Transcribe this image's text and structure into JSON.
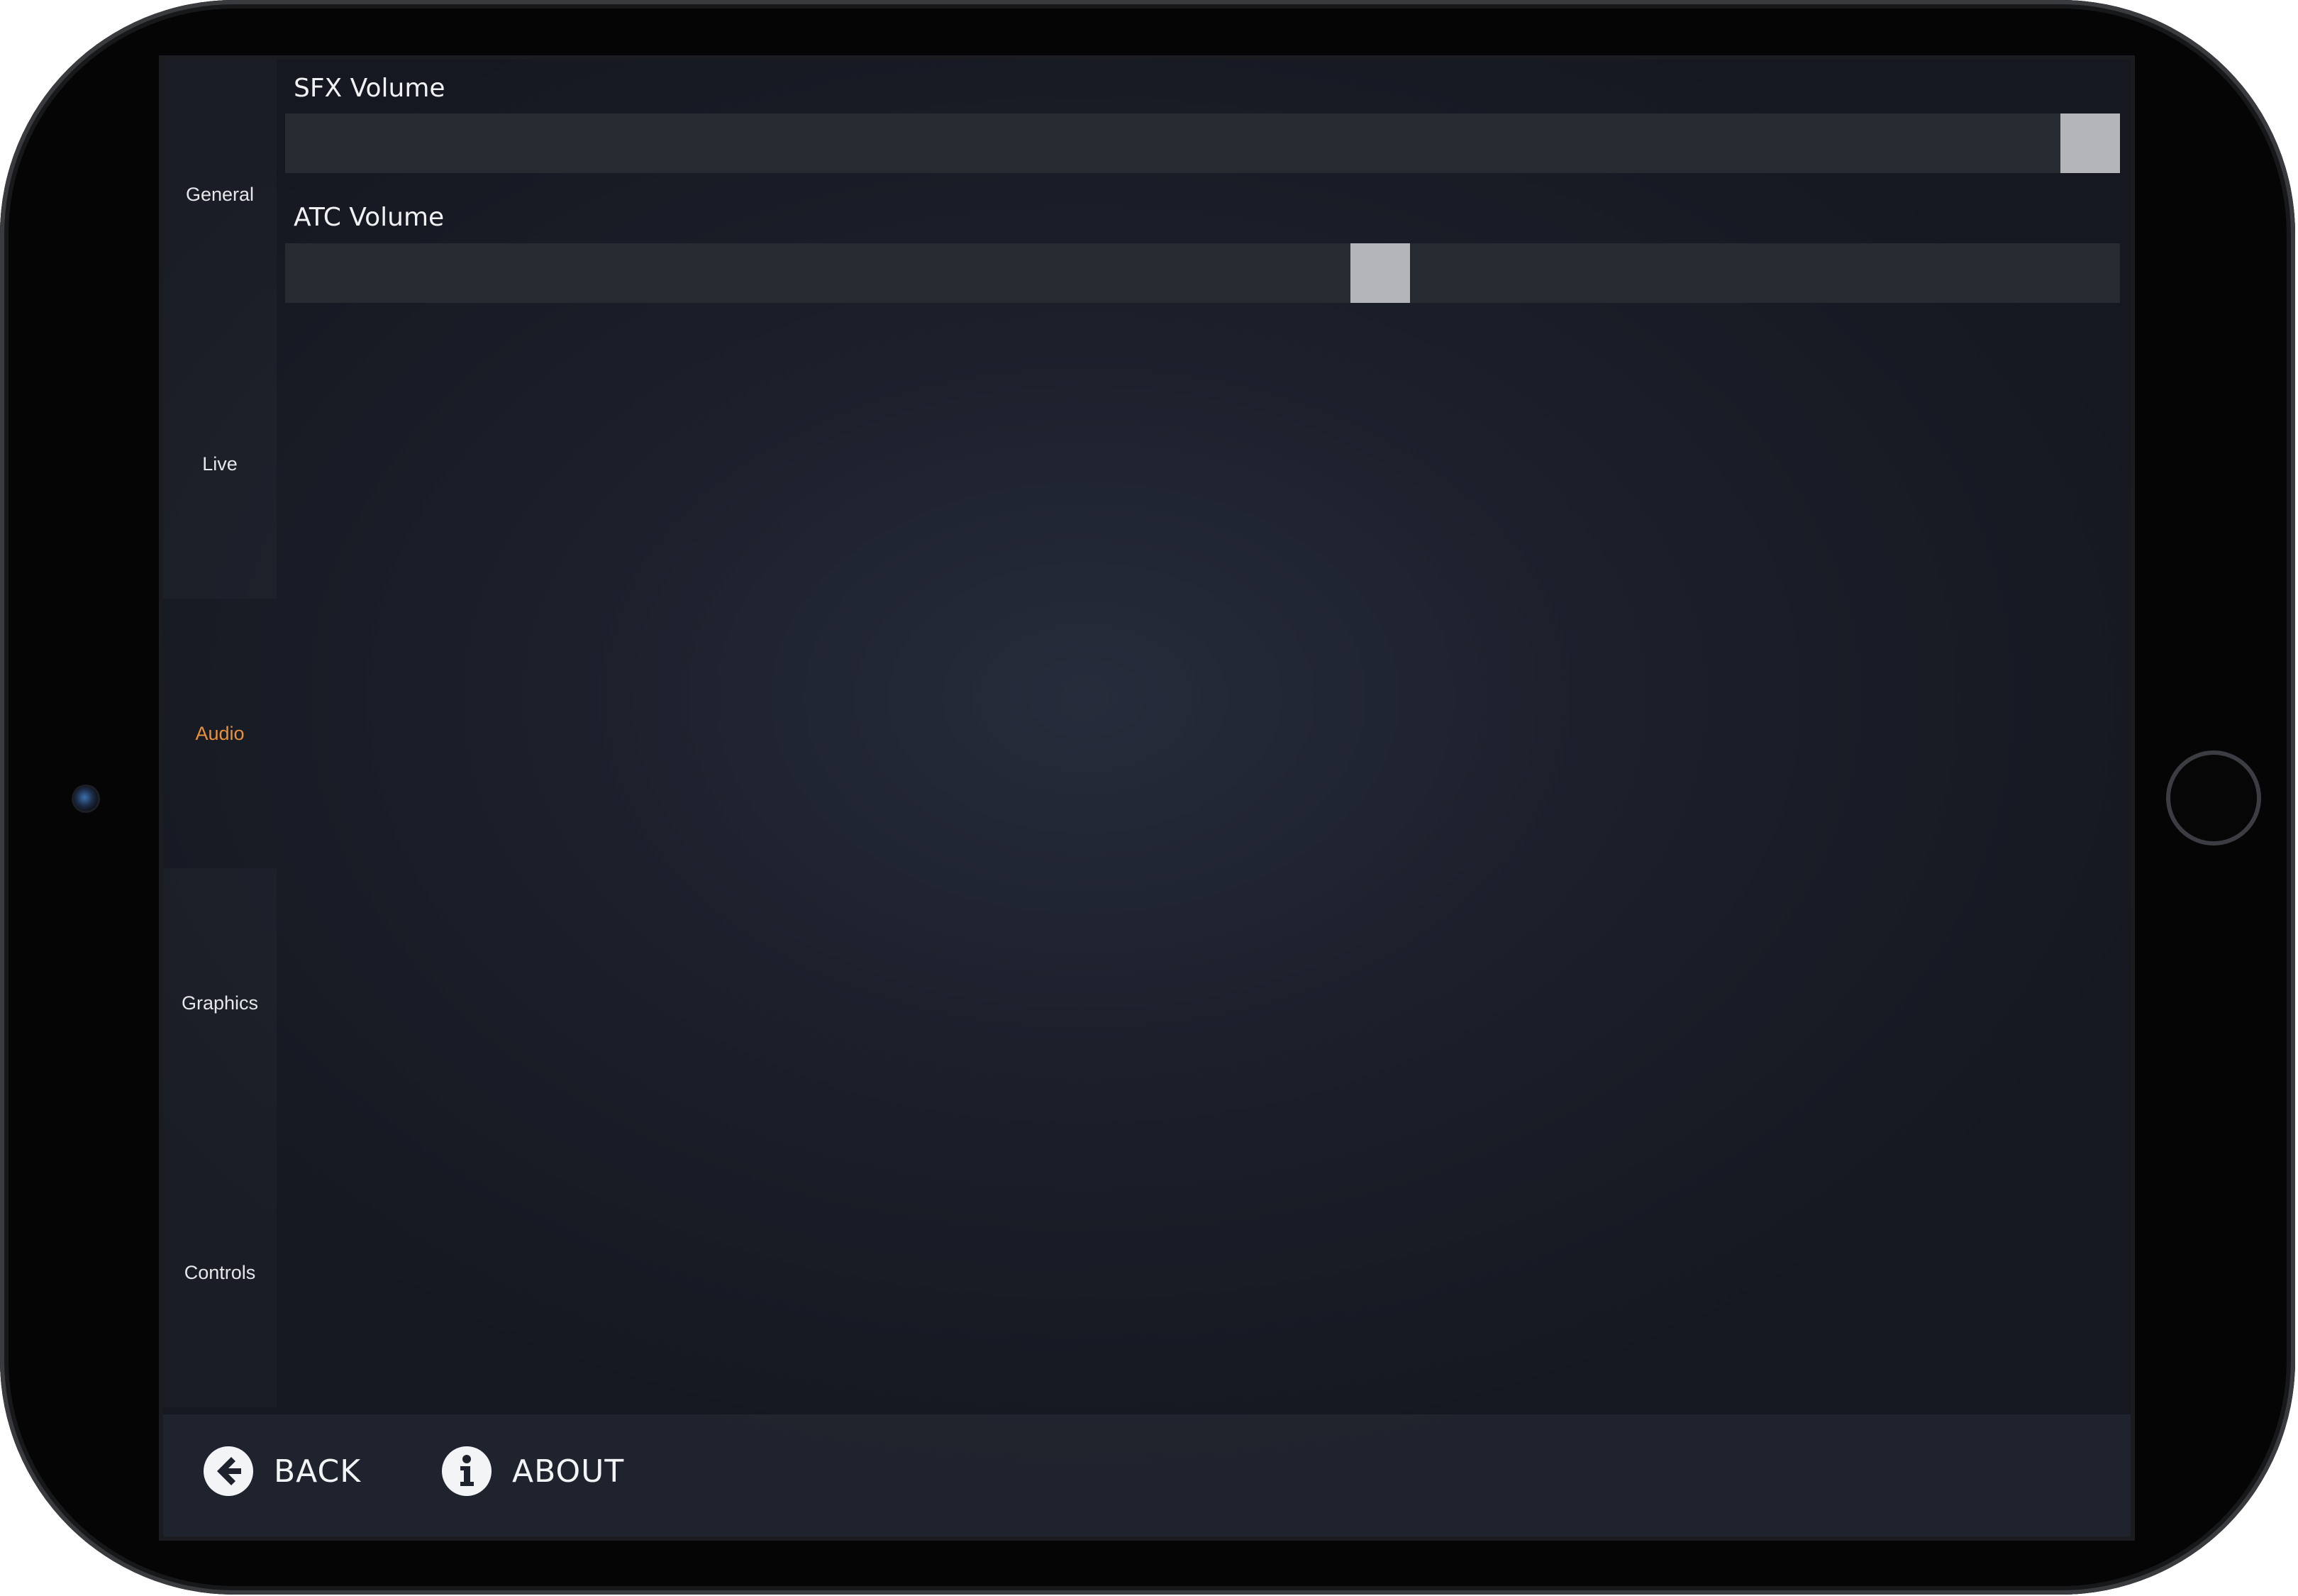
{
  "sidebar": {
    "items": [
      {
        "label": "General"
      },
      {
        "label": "Live"
      },
      {
        "label": "Audio",
        "active": true
      },
      {
        "label": "Graphics"
      },
      {
        "label": "Controls"
      }
    ]
  },
  "audio": {
    "sfx_volume": {
      "label": "SFX Volume",
      "value": 1.0
    },
    "atc_volume": {
      "label": "ATC Volume",
      "value": 0.6
    }
  },
  "footer": {
    "back_label": "BACK",
    "back_icon": "arrow-left-circle-icon",
    "about_label": "ABOUT",
    "about_icon": "info-circle-icon"
  },
  "colors": {
    "accent_active": "#e8913a",
    "thumb": "#b3b5b9",
    "track": "#262a31"
  }
}
